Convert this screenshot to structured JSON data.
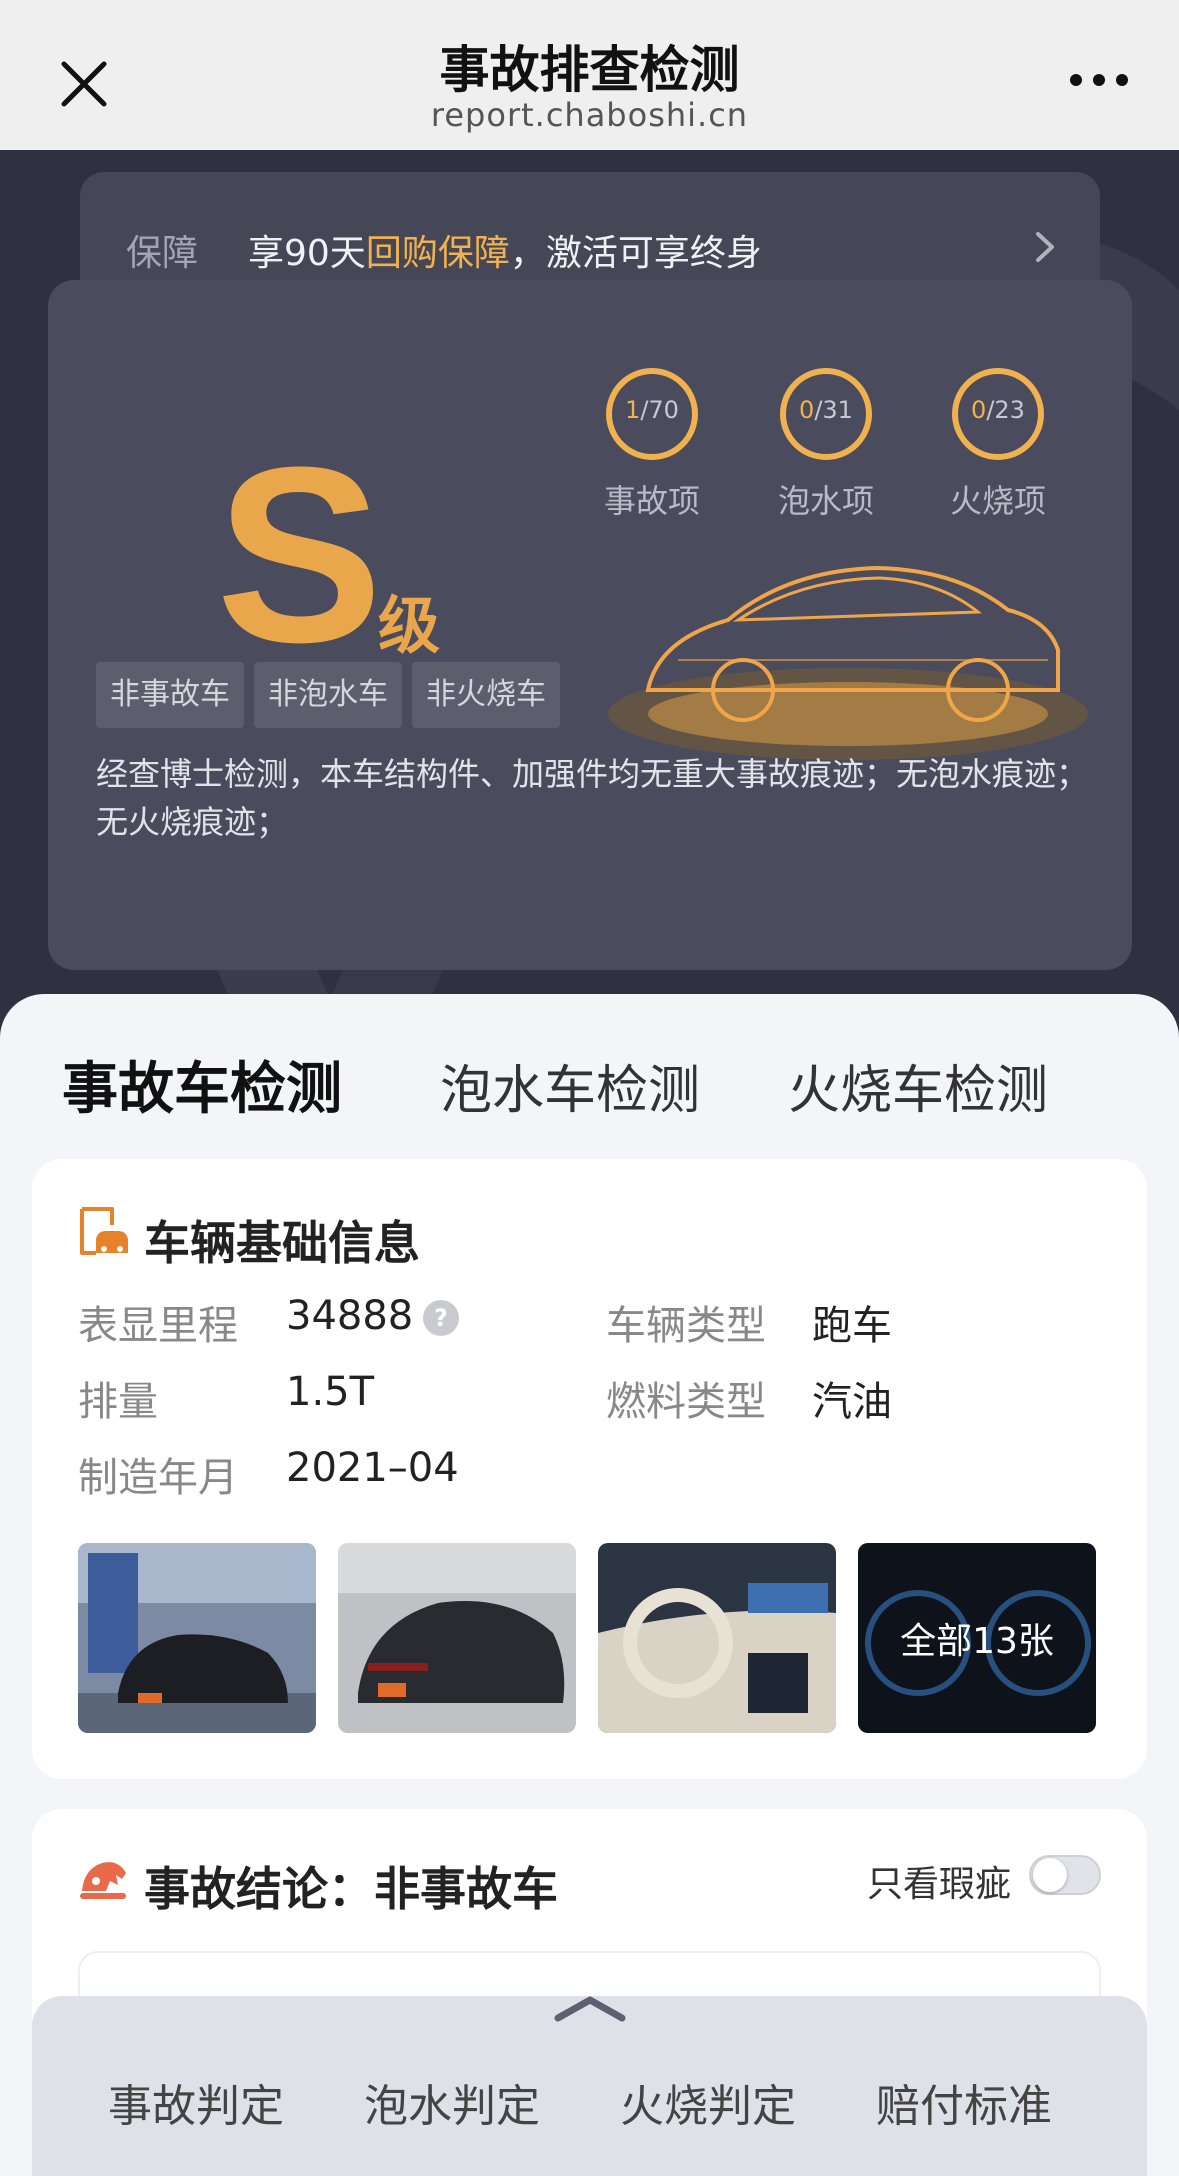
{
  "topbar": {
    "title": "事故排查检测",
    "url": "report.chaboshi.cn",
    "close_icon": "close-icon",
    "more_icon": "more-horizontal-icon"
  },
  "guarantee": {
    "label": "保障",
    "text_prefix": "享90天",
    "text_highlight": "回购保障",
    "text_suffix": "，激活可享终身"
  },
  "grade": {
    "letter": "S",
    "unit": "级"
  },
  "rings": [
    {
      "current": "1",
      "total": "/70",
      "label": "事故项"
    },
    {
      "current": "0",
      "total": "/31",
      "label": "泡水项"
    },
    {
      "current": "0",
      "total": "/23",
      "label": "火烧项"
    }
  ],
  "tags": [
    "非事故车",
    "非泡水车",
    "非火烧车"
  ],
  "hero_desc": "经查博士检测，本车结构件、加强件均无重大事故痕迹；无泡水痕迹；无火烧痕迹；",
  "tabs": [
    {
      "label": "事故车检测",
      "active": true
    },
    {
      "label": "泡水车检测",
      "active": false
    },
    {
      "label": "火烧车检测",
      "active": false
    }
  ],
  "vehicle_info": {
    "title": "车辆基础信息",
    "fields": {
      "mileage_label": "表显里程",
      "mileage_value": "34888",
      "type_label": "车辆类型",
      "type_value": "跑车",
      "displacement_label": "排量",
      "displacement_value": "1.5T",
      "fuel_label": "燃料类型",
      "fuel_value": "汽油",
      "date_label": "制造年月",
      "date_value": "2021–04"
    },
    "photos_all_label": "全部13张"
  },
  "conclusion": {
    "title": "事故结论：非事故车",
    "filter_label": "只看瑕疵",
    "filter_on": false
  },
  "bottom_nav": [
    "事故判定",
    "泡水判定",
    "火烧判定",
    "赔付标准"
  ],
  "colors": {
    "accent": "#eaa64a",
    "hero_bg": "#2f3140",
    "tab_underline": "#e8822a"
  }
}
